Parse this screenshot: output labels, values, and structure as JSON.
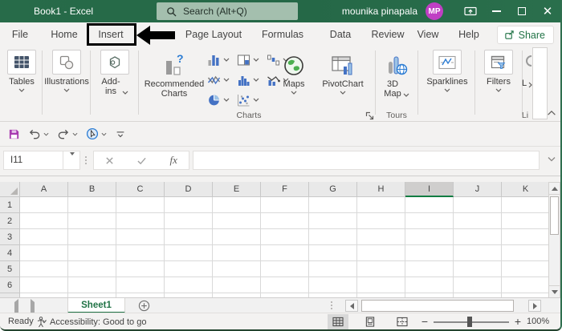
{
  "titlebar": {
    "title": "Book1 - Excel",
    "search_placeholder": "Search (Alt+Q)",
    "user_name": "mounika pinapala",
    "user_initials": "MP"
  },
  "menubar": {
    "tabs": [
      "File",
      "Home",
      "Insert",
      "Page Layout",
      "Formulas",
      "Data",
      "Review",
      "View",
      "Help"
    ],
    "active_tab": "Insert",
    "share_label": "Share"
  },
  "ribbon": {
    "tables_label": "Tables",
    "illustrations_label": "Illustrations",
    "addins_label": "Add-\nins",
    "recommended_charts_label": "Recommended\nCharts",
    "recommended_charts_glyph": "?",
    "maps_label": "Maps",
    "pivotchart_label": "PivotChart",
    "map3d_label": "3D\nMap",
    "sparklines_label": "Sparklines",
    "filters_label": "Filters",
    "link_label_partial": "L",
    "group_charts": "Charts",
    "group_tours": "Tours",
    "group_links_partial": "Li"
  },
  "formula_bar": {
    "name_box_value": "I11",
    "insert_function_label": "fx",
    "formula_value": ""
  },
  "grid": {
    "columns": [
      "A",
      "B",
      "C",
      "D",
      "E",
      "F",
      "G",
      "H",
      "I",
      "J",
      "K"
    ],
    "rows": [
      "1",
      "2",
      "3",
      "4",
      "5",
      "6"
    ],
    "selected_cell": "I11",
    "selected_column": "I"
  },
  "sheet_bar": {
    "active_sheet": "Sheet1"
  },
  "status_bar": {
    "mode": "Ready",
    "accessibility": "Accessibility: Good to go",
    "zoom_out": "−",
    "zoom_in": "+",
    "zoom_level": "100%"
  },
  "colors": {
    "titlebar_green": "#266b48",
    "accent_green": "#217346",
    "header_select_green": "#107c41",
    "avatar_magenta": "#c03fc4",
    "save_icon_magenta": "#a73ab0",
    "chart_blue": "#4472c4"
  }
}
